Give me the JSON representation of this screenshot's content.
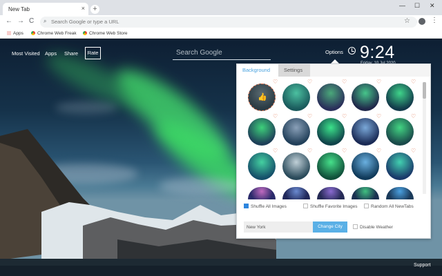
{
  "browser": {
    "tab_title": "New Tab",
    "tab_close": "×",
    "new_tab": "+",
    "win_min": "—",
    "win_max": "☐",
    "win_close": "✕",
    "back": "←",
    "forward": "→",
    "reload": "C",
    "omnibox_placeholder": "Search Google or type a URL",
    "bookmarks": [
      "Apps",
      "Chrome Web Freak",
      "Chrome Web Store"
    ]
  },
  "page": {
    "links": [
      "Most Visited",
      "Apps",
      "Share"
    ],
    "rate_label": "Rate",
    "search_placeholder": "Search Google",
    "options_label": "Options",
    "time": "9:24",
    "date": "Friday, 10 Jul 2020",
    "support_label": "Support"
  },
  "panel": {
    "tabs": [
      "Background",
      "Settings"
    ],
    "active_tab": "Background",
    "thumb_count": 25,
    "checkboxes": [
      {
        "label": "Shuffle All Images",
        "checked": true
      },
      {
        "label": "Shuffle Favorite Images",
        "checked": false
      },
      {
        "label": "Random All NewTabs",
        "checked": false
      }
    ],
    "city_value": "New York",
    "change_city_label": "Change City",
    "weather_label": "Disable Weather"
  },
  "icons": {
    "heart": "♡",
    "star": "☆",
    "menu": "⋮",
    "search": "⌕"
  },
  "colors": {
    "accent": "#5ab0e6",
    "aurora_green": "#3ee26a",
    "heart": "#e0704b"
  }
}
